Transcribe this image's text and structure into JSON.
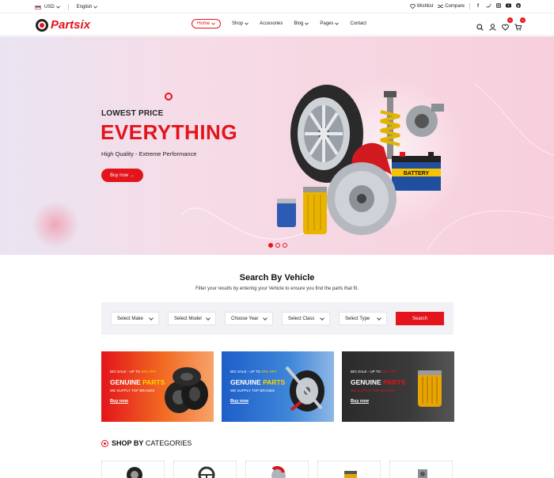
{
  "topbar": {
    "currency": "USD",
    "language": "English",
    "wishlist": "Wishlist",
    "compare": "Compare",
    "social": [
      "f",
      "t",
      "ig",
      "yt",
      "p"
    ]
  },
  "header": {
    "logo_text": "Partsix",
    "nav": [
      {
        "label": "Home",
        "active": true
      },
      {
        "label": "Shop"
      },
      {
        "label": "Accesories"
      },
      {
        "label": "Blog"
      },
      {
        "label": "Pages"
      },
      {
        "label": "Contact"
      }
    ],
    "wishlist_count": "0",
    "cart_count": "0"
  },
  "hero": {
    "eyebrow": "LOWEST PRICE",
    "headline": "EVERYTHING",
    "subtitle": "High Quality - Extreme Performance",
    "button": "Buy now →",
    "battery_label": "BATTERY",
    "slides": 3,
    "active_slide": 1
  },
  "search_vehicle": {
    "title": "Search By Vehicle",
    "description": "Filter your results by entering your Vehicle to ensure you find the parts that fit.",
    "selects": [
      "Select Make",
      "Select Model",
      "Choose Year",
      "Select Class",
      "Select Type"
    ],
    "button": "Search"
  },
  "promos": [
    {
      "small_prefix": "BIG SALE - UP TO ",
      "small_hl": "40% OFF",
      "big_a": "GENUINE ",
      "big_b": "PARTS",
      "tag": "WE SUPPLY TOP BRANDS",
      "cta": "Buy now"
    },
    {
      "small_prefix": "BIG SALE - UP TO ",
      "small_hl": "40% OFF",
      "big_a": "GENUINE ",
      "big_b": "PARTS",
      "tag": "WE SUPPLY TOP BRANDS",
      "cta": "Buy now"
    },
    {
      "small_prefix": "BIG SALE - UP TO ",
      "small_hl": "40% OFF",
      "big_a": "GENUINE ",
      "big_b": "PARTS",
      "tag": "WE SUPPLY TOP BRANDS",
      "cta": "Buy now"
    }
  ],
  "categories": {
    "title_bold": "SHOP BY",
    "title_rest": " CATEGORIES",
    "items": [
      "wheel-icon",
      "steering-wheel-icon",
      "brake-disc-icon",
      "engine-part-icon",
      "transmission-icon"
    ]
  },
  "colors": {
    "accent": "#e3141b",
    "promo_orange": "#f26a22",
    "promo_blue": "#1d5ec9",
    "promo_dark": "#2b2b2b"
  }
}
